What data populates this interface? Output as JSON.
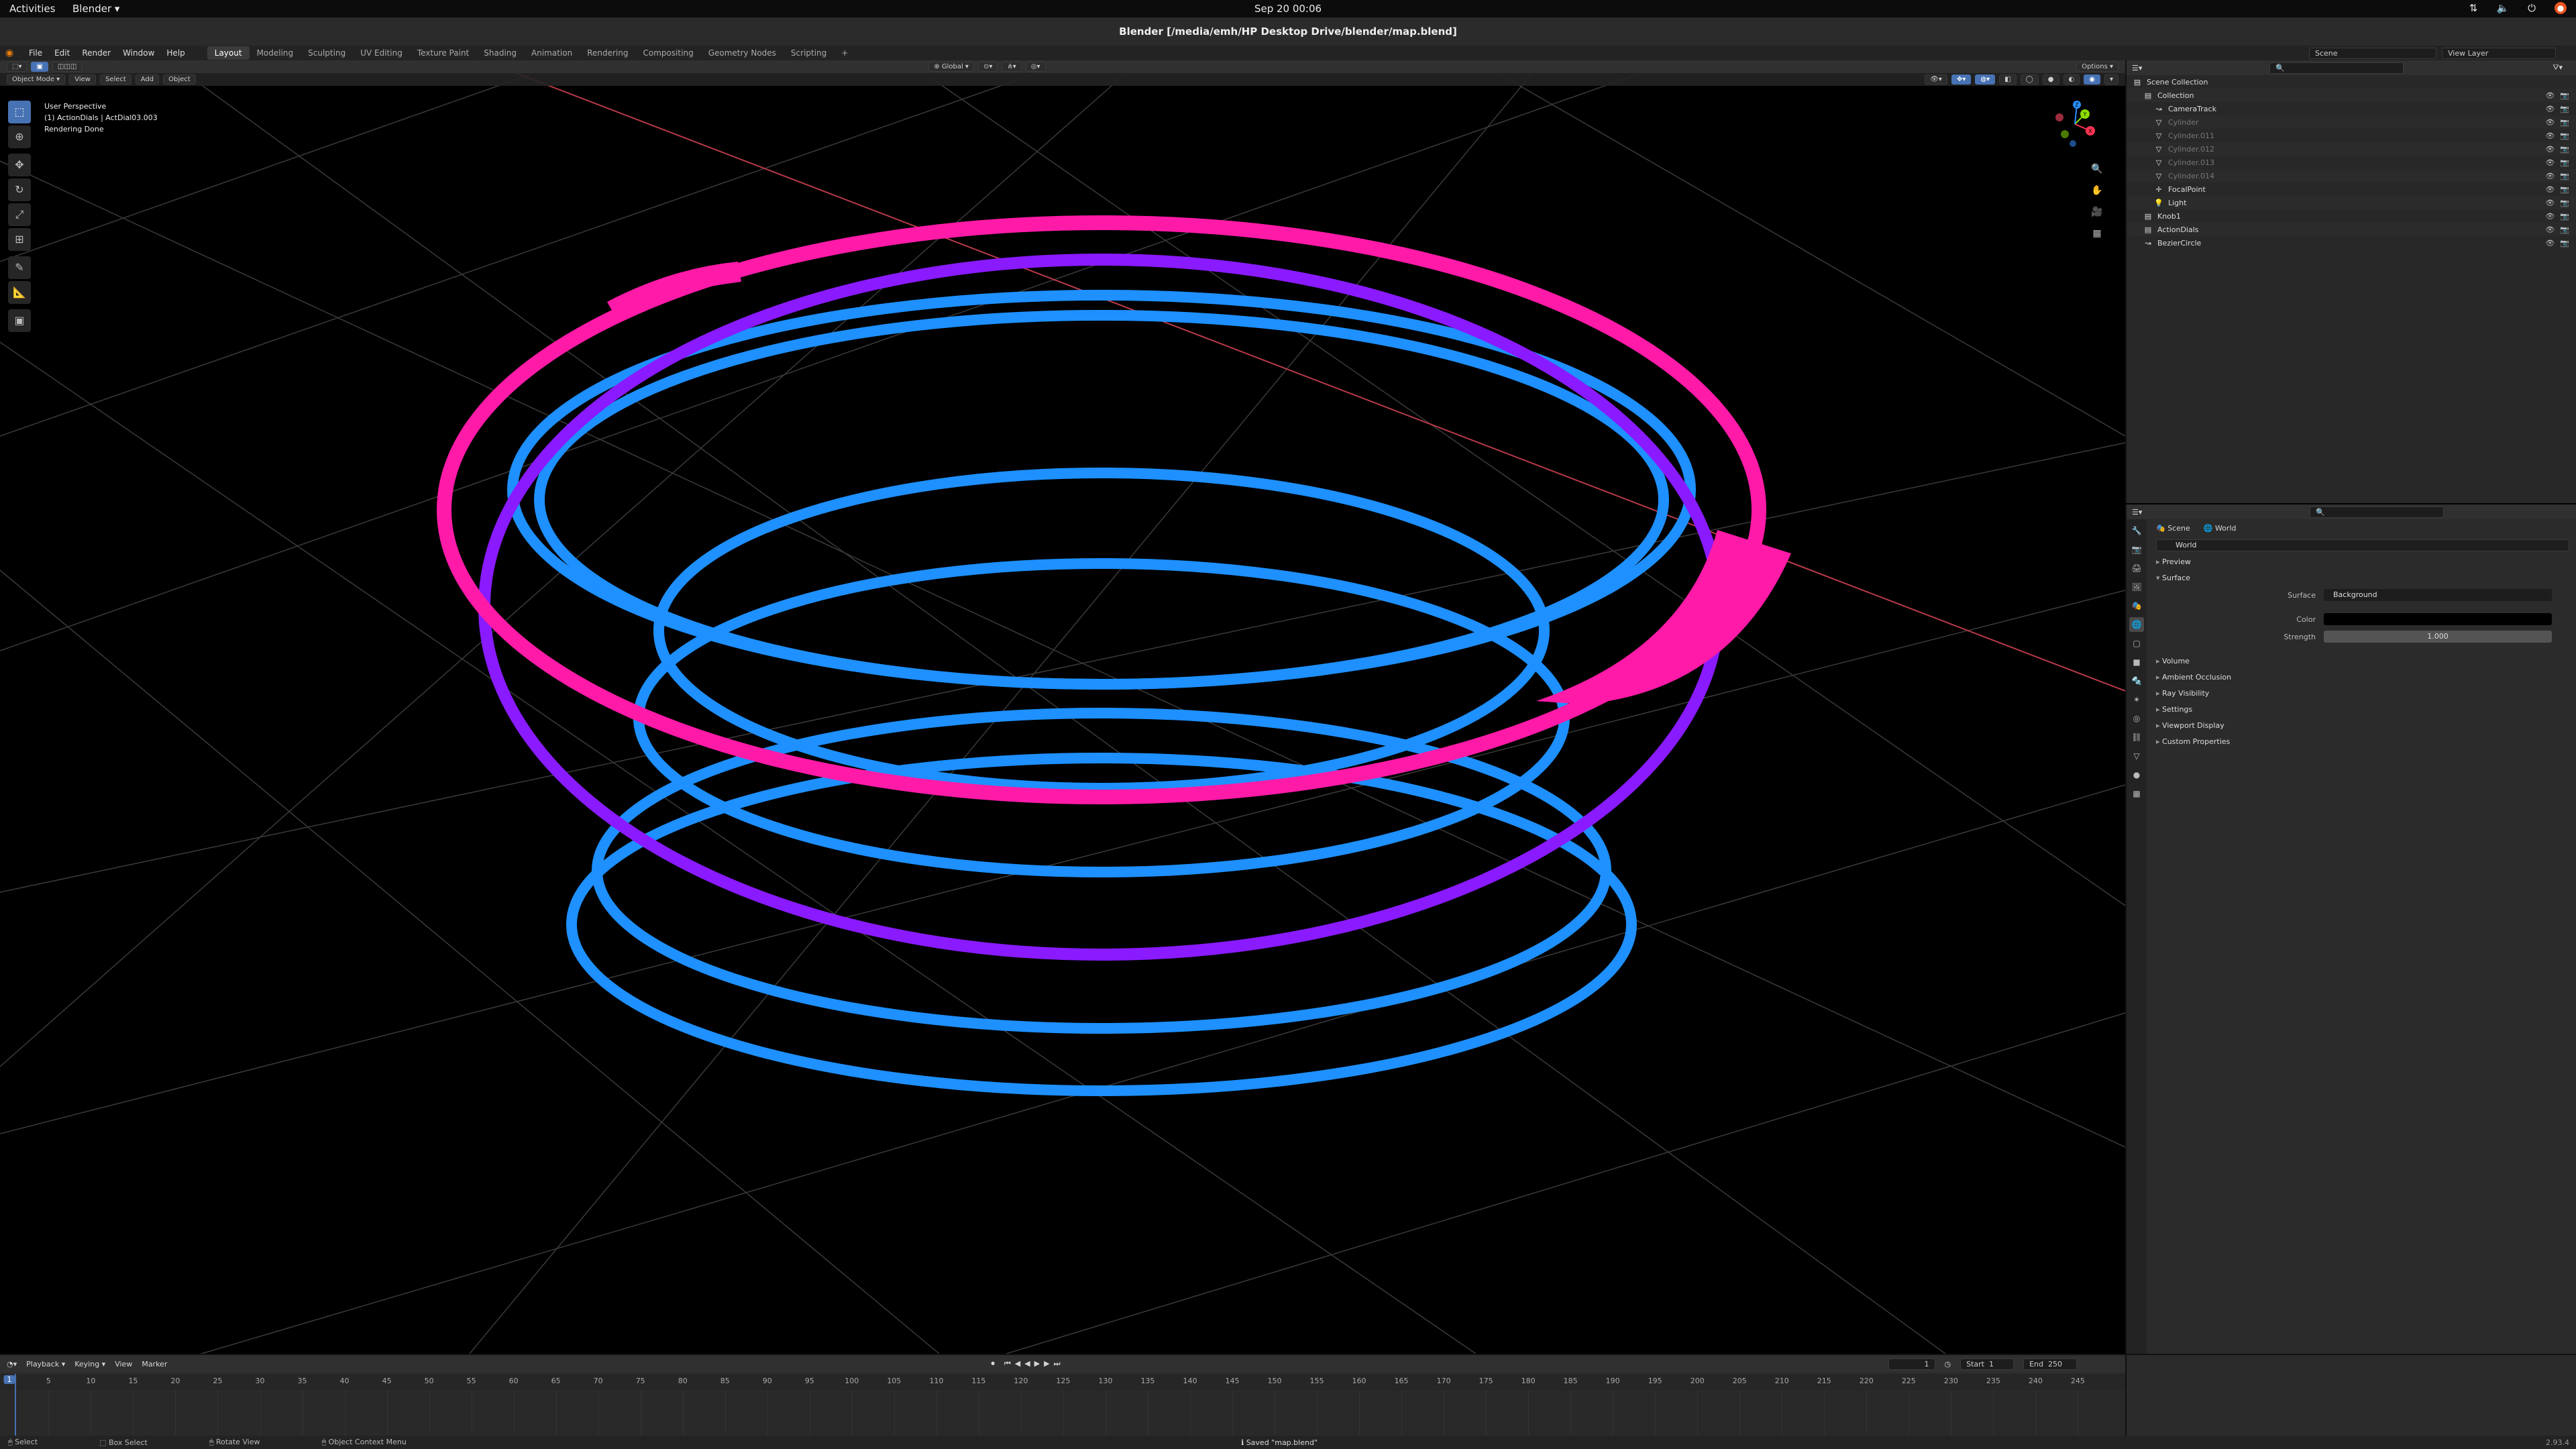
{
  "system": {
    "activities": "Activities",
    "app_name": "Blender ▾",
    "clock": "Sep 20  00:06"
  },
  "window": {
    "title": "Blender [/media/emh/HP Desktop Drive/blender/map.blend]"
  },
  "menu": {
    "items": [
      "File",
      "Edit",
      "Render",
      "Window",
      "Help"
    ],
    "workspaces": [
      "Layout",
      "Modeling",
      "Sculpting",
      "UV Editing",
      "Texture Paint",
      "Shading",
      "Animation",
      "Rendering",
      "Compositing",
      "Geometry Nodes",
      "Scripting"
    ],
    "active_workspace": "Layout",
    "add_tab": "+",
    "scene": "Scene",
    "view_layer": "View Layer"
  },
  "viewport": {
    "mode": "Object Mode",
    "menus": [
      "View",
      "Select",
      "Add",
      "Object"
    ],
    "transform_orientation": "Global",
    "options": "Options ▾",
    "overlay_lines": [
      "User Perspective",
      "(1) ActionDials | ActDial03.003",
      "Rendering Done"
    ],
    "gizmo_axes": [
      "X",
      "Y",
      "Z"
    ]
  },
  "outliner": {
    "root": "Scene Collection",
    "items": [
      {
        "name": "Collection",
        "indent": 1,
        "icon": "collection-icon",
        "dim": false
      },
      {
        "name": "CameraTrack",
        "indent": 2,
        "icon": "curve-icon",
        "dim": false
      },
      {
        "name": "Cylinder",
        "indent": 2,
        "icon": "mesh-icon",
        "dim": true
      },
      {
        "name": "Cylinder.011",
        "indent": 2,
        "icon": "mesh-icon",
        "dim": true
      },
      {
        "name": "Cylinder.012",
        "indent": 2,
        "icon": "mesh-icon",
        "dim": true
      },
      {
        "name": "Cylinder.013",
        "indent": 2,
        "icon": "mesh-icon",
        "dim": true
      },
      {
        "name": "Cylinder.014",
        "indent": 2,
        "icon": "mesh-icon",
        "dim": true
      },
      {
        "name": "FocalPoint",
        "indent": 2,
        "icon": "empty-icon",
        "dim": false
      },
      {
        "name": "Light",
        "indent": 2,
        "icon": "light-icon",
        "dim": false
      },
      {
        "name": "Knob1",
        "indent": 1,
        "icon": "collection-icon",
        "dim": false
      },
      {
        "name": "ActionDials",
        "indent": 1,
        "icon": "collection-icon",
        "dim": false
      },
      {
        "name": "BezierCircle",
        "indent": 1,
        "icon": "curve-icon",
        "dim": false
      }
    ]
  },
  "properties": {
    "crumb_scene": "Scene",
    "crumb_world": "World",
    "world_name": "World",
    "sections_top": [
      "Preview",
      "Surface"
    ],
    "surface_label": "Surface",
    "surface_value": "Background",
    "color_label": "Color",
    "strength_label": "Strength",
    "strength_value": "1.000",
    "sections_bottom": [
      "Volume",
      "Ambient Occlusion",
      "Ray Visibility",
      "Settings",
      "Viewport Display",
      "Custom Properties"
    ]
  },
  "timeline": {
    "menus": [
      "Playback ▾",
      "Keying ▾",
      "View",
      "Marker"
    ],
    "current_frame": "1",
    "start_label": "Start",
    "start": "1",
    "end_label": "End",
    "end": "250",
    "ticks": [
      "5",
      "10",
      "15",
      "20",
      "25",
      "30",
      "35",
      "40",
      "45",
      "50",
      "55",
      "60",
      "65",
      "70",
      "75",
      "80",
      "85",
      "90",
      "95",
      "100",
      "105",
      "110",
      "115",
      "120",
      "125",
      "130",
      "135",
      "140",
      "145",
      "150",
      "155",
      "160",
      "165",
      "170",
      "175",
      "180",
      "185",
      "190",
      "195",
      "200",
      "205",
      "210",
      "215",
      "220",
      "225",
      "230",
      "235",
      "240",
      "245"
    ]
  },
  "status": {
    "select": "Select",
    "box_select": "Box Select",
    "rotate_view": "Rotate View",
    "context_menu": "Object Context Menu",
    "saved": "Saved \"map.blend\"",
    "version": "2.93.4"
  },
  "colors": {
    "ring_blue": "#1e90ff",
    "ring_pink": "#ff1aa8",
    "ring_purple": "#8a1aff",
    "accent": "#4772b3"
  }
}
